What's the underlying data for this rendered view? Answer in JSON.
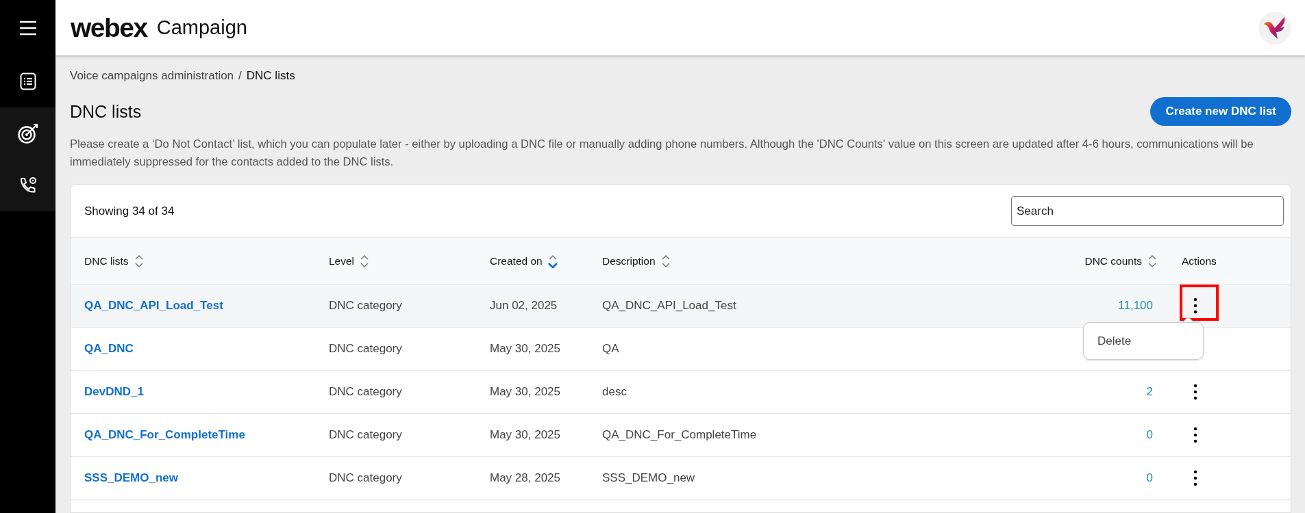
{
  "sidebar": {
    "items": [
      {
        "kind": "menu",
        "selected": false
      },
      {
        "kind": "list",
        "selected": false
      },
      {
        "kind": "target",
        "selected": true
      },
      {
        "kind": "phone",
        "selected": true
      }
    ]
  },
  "header": {
    "brand": "webex",
    "product": "Campaign"
  },
  "breadcrumb": {
    "parent": "Voice campaigns administration",
    "separator": "/",
    "current": "DNC lists"
  },
  "page": {
    "title": "DNC lists",
    "create_button": "Create new DNC list",
    "description": "Please create a ‘Do Not Contact’ list, which you can populate later - either by uploading a DNC file or manually adding phone numbers. Although the 'DNC Counts' value on this screen are updated after 4-6 hours, communications will be immediately suppressed for the contacts added to the DNC lists."
  },
  "table": {
    "showing": "Showing 34 of 34",
    "search": {
      "placeholder": "Search"
    },
    "columns": [
      {
        "label": "DNC lists",
        "sortable": true,
        "sorted": false
      },
      {
        "label": "Level",
        "sortable": true,
        "sorted": false
      },
      {
        "label": "Created on",
        "sortable": true,
        "sorted": true
      },
      {
        "label": "Description",
        "sortable": true,
        "sorted": false
      },
      {
        "label": "DNC counts",
        "sortable": true,
        "sorted": false
      },
      {
        "label": "Actions",
        "sortable": false
      }
    ],
    "rows": [
      {
        "name": "QA_DNC_API_Load_Test",
        "level": "DNC category",
        "created": "Jun 02, 2025",
        "description": "QA_DNC_API_Load_Test",
        "count": "11,100",
        "hovered": true,
        "highlighted": true,
        "menu": [
          "Delete"
        ]
      },
      {
        "name": "QA_DNC",
        "level": "DNC category",
        "created": "May 30, 2025",
        "description": "QA",
        "hovered": false,
        "highlighted": false
      },
      {
        "name": "DevDND_1",
        "level": "DNC category",
        "created": "May 30, 2025",
        "description": "desc",
        "count": "2",
        "hovered": false,
        "highlighted": false
      },
      {
        "name": "QA_DNC_For_CompleteTime",
        "level": "DNC category",
        "created": "May 30, 2025",
        "description": "QA_DNC_For_CompleteTime",
        "count": "0",
        "hovered": false,
        "highlighted": false
      },
      {
        "name": "SSS_DEMO_new",
        "level": "DNC category",
        "created": "May 28, 2025",
        "description": "SSS_DEMO_new",
        "count": "0",
        "hovered": false,
        "highlighted": false
      }
    ]
  }
}
